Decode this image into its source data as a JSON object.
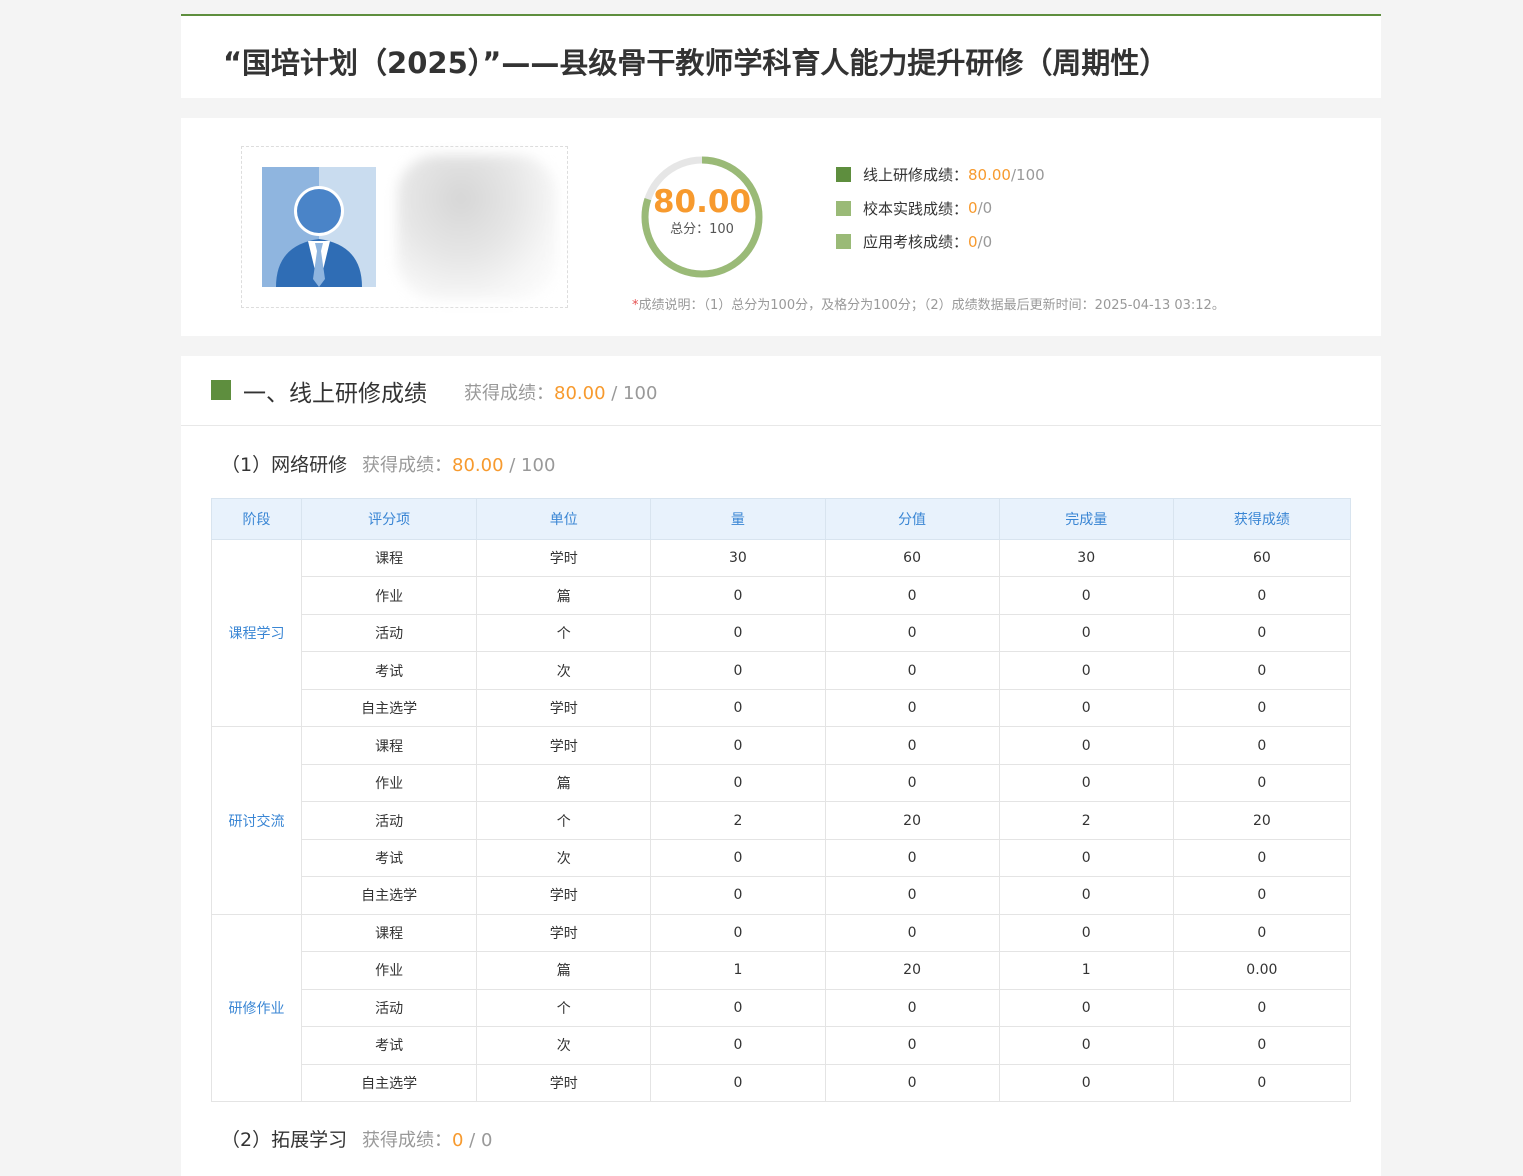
{
  "page_title": "“国培计划（2025）”——县级骨干教师学科育人能力提升研修（周期性）",
  "summary": {
    "total_score": "80.00",
    "total_label": "总分：",
    "total_value": "100",
    "ring_fraction": 0.8,
    "ring_color": "#9aba77",
    "ring_track_color": "#e6e6e6",
    "items": [
      {
        "label": "线上研修成绩：",
        "score": "80.00",
        "sep": " / ",
        "max": "100",
        "color": "#5e8e3e"
      },
      {
        "label": "校本实践成绩：",
        "score": "0",
        "sep": " / ",
        "max": "0",
        "color": "#9aba77"
      },
      {
        "label": "应用考核成绩：",
        "score": "0",
        "sep": " / ",
        "max": "0",
        "color": "#9aba77"
      }
    ],
    "note_star": "*",
    "note_text": "成绩说明：（1）总分为100分，及格分为100分；（2）成绩数据最后更新时间：2025-04-13 03:12。"
  },
  "section1": {
    "title": "一、线上研修成绩",
    "score_label": "获得成绩：",
    "score": "80.00",
    "sep": " / ",
    "max": "100"
  },
  "sub1": {
    "title": "（1）网络研修",
    "score_label": "获得成绩：",
    "score": "80.00",
    "sep": " / ",
    "max": "100"
  },
  "sub2": {
    "title": "（2）拓展学习",
    "score_label": "获得成绩：",
    "score": "0",
    "sep": " / ",
    "max": "0"
  },
  "table": {
    "headers": [
      "阶段",
      "评分项",
      "单位",
      "量",
      "分值",
      "完成量",
      "获得成绩"
    ],
    "groups": [
      {
        "stage": "课程学习",
        "rows": [
          [
            "课程",
            "学时",
            "30",
            "60",
            "30",
            "60"
          ],
          [
            "作业",
            "篇",
            "0",
            "0",
            "0",
            "0"
          ],
          [
            "活动",
            "个",
            "0",
            "0",
            "0",
            "0"
          ],
          [
            "考试",
            "次",
            "0",
            "0",
            "0",
            "0"
          ],
          [
            "自主选学",
            "学时",
            "0",
            "0",
            "0",
            "0"
          ]
        ]
      },
      {
        "stage": "研讨交流",
        "rows": [
          [
            "课程",
            "学时",
            "0",
            "0",
            "0",
            "0"
          ],
          [
            "作业",
            "篇",
            "0",
            "0",
            "0",
            "0"
          ],
          [
            "活动",
            "个",
            "2",
            "20",
            "2",
            "20"
          ],
          [
            "考试",
            "次",
            "0",
            "0",
            "0",
            "0"
          ],
          [
            "自主选学",
            "学时",
            "0",
            "0",
            "0",
            "0"
          ]
        ]
      },
      {
        "stage": "研修作业",
        "rows": [
          [
            "课程",
            "学时",
            "0",
            "0",
            "0",
            "0"
          ],
          [
            "作业",
            "篇",
            "1",
            "20",
            "1",
            "0.00"
          ],
          [
            "活动",
            "个",
            "0",
            "0",
            "0",
            "0"
          ],
          [
            "考试",
            "次",
            "0",
            "0",
            "0",
            "0"
          ],
          [
            "自主选学",
            "学时",
            "0",
            "0",
            "0",
            "0"
          ]
        ]
      }
    ]
  }
}
